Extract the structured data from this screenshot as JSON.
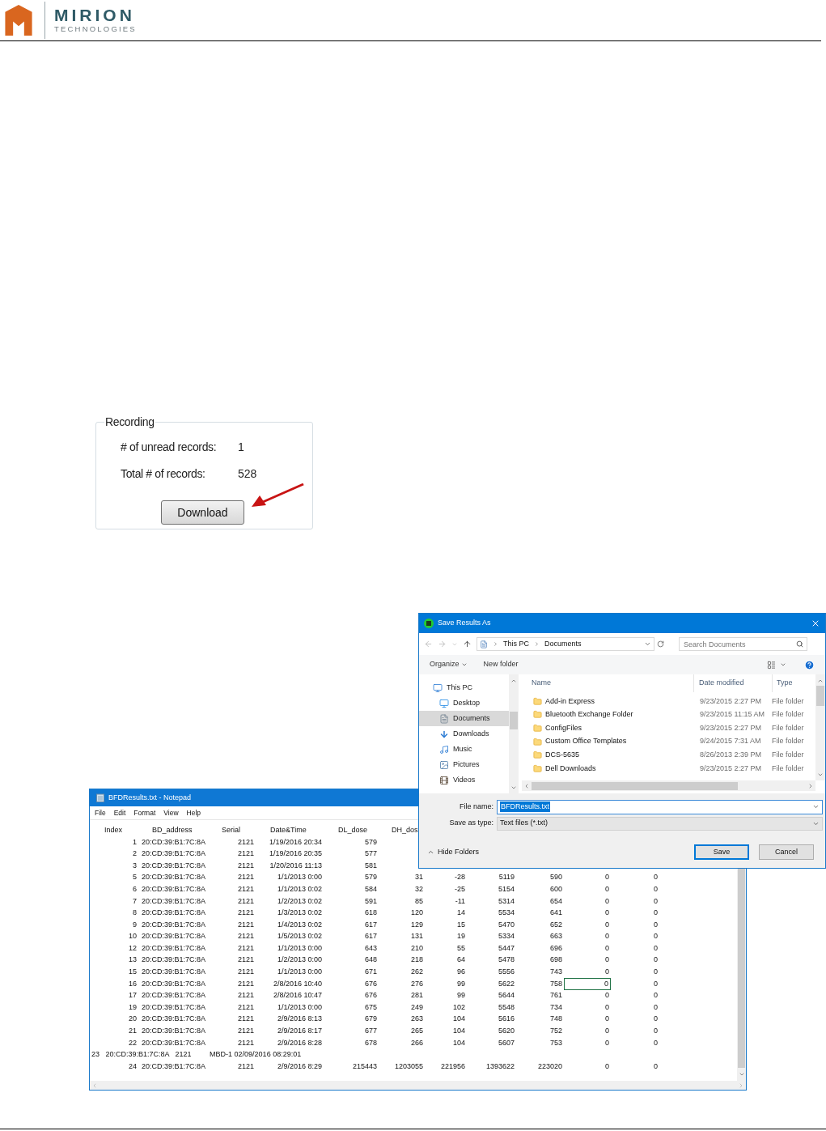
{
  "header": {
    "brand_name": "MIRION",
    "brand_tagline": "TECHNOLOGIES"
  },
  "recording": {
    "title": "Recording",
    "fields": [
      {
        "label": "# of unread records:",
        "value": "1"
      },
      {
        "label": "Total # of records:",
        "value": "528"
      }
    ],
    "button": "Download"
  },
  "notepad": {
    "title": "BFDResults.txt - Notepad",
    "menu": [
      "File",
      "Edit",
      "Format",
      "View",
      "Help"
    ],
    "columns": [
      "Index",
      "BD_address",
      "Serial",
      "Date&Time",
      "DL_dose",
      "DH_dos"
    ],
    "rows": [
      {
        "kind": "record",
        "cells": [
          "1",
          "20:CD:39:B1:7C:8A",
          "2121",
          "1/19/2016 20:34",
          "579"
        ]
      },
      {
        "kind": "record",
        "cells": [
          "2",
          "20:CD:39:B1:7C:8A",
          "2121",
          "1/19/2016 20:35",
          "577"
        ]
      },
      {
        "kind": "record",
        "cells": [
          "3",
          "20:CD:39:B1:7C:8A",
          "2121",
          "1/20/2016 11:13",
          "581"
        ]
      },
      {
        "kind": "record",
        "cells": [
          "5",
          "20:CD:39:B1:7C:8A",
          "2121",
          "1/1/2013 0:00",
          "579",
          "31",
          "-28",
          "5119",
          "590",
          "0",
          "0"
        ]
      },
      {
        "kind": "record",
        "cells": [
          "6",
          "20:CD:39:B1:7C:8A",
          "2121",
          "1/1/2013 0:02",
          "584",
          "32",
          "-25",
          "5154",
          "600",
          "0",
          "0"
        ]
      },
      {
        "kind": "record",
        "cells": [
          "7",
          "20:CD:39:B1:7C:8A",
          "2121",
          "1/2/2013 0:02",
          "591",
          "85",
          "-11",
          "5314",
          "654",
          "0",
          "0"
        ]
      },
      {
        "kind": "record",
        "cells": [
          "8",
          "20:CD:39:B1:7C:8A",
          "2121",
          "1/3/2013 0:02",
          "618",
          "120",
          "14",
          "5534",
          "641",
          "0",
          "0"
        ]
      },
      {
        "kind": "record",
        "cells": [
          "9",
          "20:CD:39:B1:7C:8A",
          "2121",
          "1/4/2013 0:02",
          "617",
          "129",
          "15",
          "5470",
          "652",
          "0",
          "0"
        ]
      },
      {
        "kind": "record",
        "cells": [
          "10",
          "20:CD:39:B1:7C:8A",
          "2121",
          "1/5/2013 0:02",
          "617",
          "131",
          "19",
          "5334",
          "663",
          "0",
          "0"
        ]
      },
      {
        "kind": "record",
        "cells": [
          "12",
          "20:CD:39:B1:7C:8A",
          "2121",
          "1/1/2013 0:00",
          "643",
          "210",
          "55",
          "5447",
          "696",
          "0",
          "0"
        ]
      },
      {
        "kind": "record",
        "cells": [
          "13",
          "20:CD:39:B1:7C:8A",
          "2121",
          "1/2/2013 0:00",
          "648",
          "218",
          "64",
          "5478",
          "698",
          "0",
          "0"
        ]
      },
      {
        "kind": "record",
        "cells": [
          "15",
          "20:CD:39:B1:7C:8A",
          "2121",
          "1/1/2013 0:00",
          "671",
          "262",
          "96",
          "5556",
          "743",
          "0",
          "0"
        ]
      },
      {
        "kind": "record",
        "cells": [
          "16",
          "20:CD:39:B1:7C:8A",
          "2121",
          "2/8/2016 10:40",
          "676",
          "276",
          "99",
          "5622",
          "758",
          {
            "text": "0",
            "selected": true
          },
          "0"
        ]
      },
      {
        "kind": "record",
        "cells": [
          "17",
          "20:CD:39:B1:7C:8A",
          "2121",
          "2/8/2016 10:47",
          "676",
          "281",
          "99",
          "5644",
          "761",
          "0",
          "0"
        ]
      },
      {
        "kind": "record",
        "cells": [
          "19",
          "20:CD:39:B1:7C:8A",
          "2121",
          "1/1/2013 0:00",
          "675",
          "249",
          "102",
          "5548",
          "734",
          "0",
          "0"
        ]
      },
      {
        "kind": "record",
        "cells": [
          "20",
          "20:CD:39:B1:7C:8A",
          "2121",
          "2/9/2016 8:13",
          "679",
          "263",
          "104",
          "5616",
          "748",
          "0",
          "0"
        ]
      },
      {
        "kind": "record",
        "cells": [
          "21",
          "20:CD:39:B1:7C:8A",
          "2121",
          "2/9/2016 8:17",
          "677",
          "265",
          "104",
          "5620",
          "752",
          "0",
          "0"
        ]
      },
      {
        "kind": "record",
        "cells": [
          "22",
          "20:CD:39:B1:7C:8A",
          "2121",
          "2/9/2016 8:28",
          "678",
          "266",
          "104",
          "5607",
          "753",
          "0",
          "0"
        ]
      },
      {
        "kind": "line",
        "text": "23   20:CD:39:B1:7C:8A   2121         MBD-1 02/09/2016 08:29:01"
      },
      {
        "kind": "record",
        "cells": [
          "24",
          "20:CD:39:B1:7C:8A",
          "2121",
          "2/9/2016 8:29",
          "215443",
          "1203055",
          "221956",
          "1393622",
          "223020",
          "0",
          "0"
        ]
      }
    ]
  },
  "save_dialog": {
    "title": "Save Results As",
    "path": [
      "This PC",
      "Documents"
    ],
    "search": {
      "placeholder": "Search Documents"
    },
    "toolbar": [
      "Organize",
      "New folder"
    ],
    "nav_items": [
      {
        "label": "This PC",
        "kind": "pc",
        "selected": false,
        "children": [
          {
            "label": "Desktop",
            "kind": "desktop",
            "selected": false
          },
          {
            "label": "Documents",
            "kind": "documents",
            "selected": true
          },
          {
            "label": "Downloads",
            "kind": "downloads",
            "selected": false
          },
          {
            "label": "Music",
            "kind": "music",
            "selected": false
          },
          {
            "label": "Pictures",
            "kind": "pictures",
            "selected": false
          },
          {
            "label": "Videos",
            "kind": "videos",
            "selected": false
          }
        ]
      }
    ],
    "columns": [
      "Name",
      "Date modified",
      "Type"
    ],
    "files": [
      {
        "name": "Add-in Express",
        "modified": "9/23/2015 2:27 PM",
        "type": "File folder"
      },
      {
        "name": "Bluetooth Exchange Folder",
        "modified": "9/23/2015 11:15 AM",
        "type": "File folder"
      },
      {
        "name": "ConfigFiles",
        "modified": "9/23/2015 2:27 PM",
        "type": "File folder"
      },
      {
        "name": "Custom Office Templates",
        "modified": "9/24/2015 7:31 AM",
        "type": "File folder"
      },
      {
        "name": "DCS-5635",
        "modified": "8/26/2013 2:39 PM",
        "type": "File folder"
      },
      {
        "name": "Dell Downloads",
        "modified": "9/23/2015 2:27 PM",
        "type": "File folder"
      }
    ],
    "file_name": {
      "label": "File name:",
      "value": "BFDResults.txt",
      "selected": true
    },
    "save_as_type": {
      "label": "Save as type:",
      "value": "Text files (*.txt)"
    },
    "hide_folders": "Hide Folders",
    "buttons": [
      {
        "label": "Save",
        "default": true
      },
      {
        "label": "Cancel",
        "default": false
      }
    ]
  }
}
